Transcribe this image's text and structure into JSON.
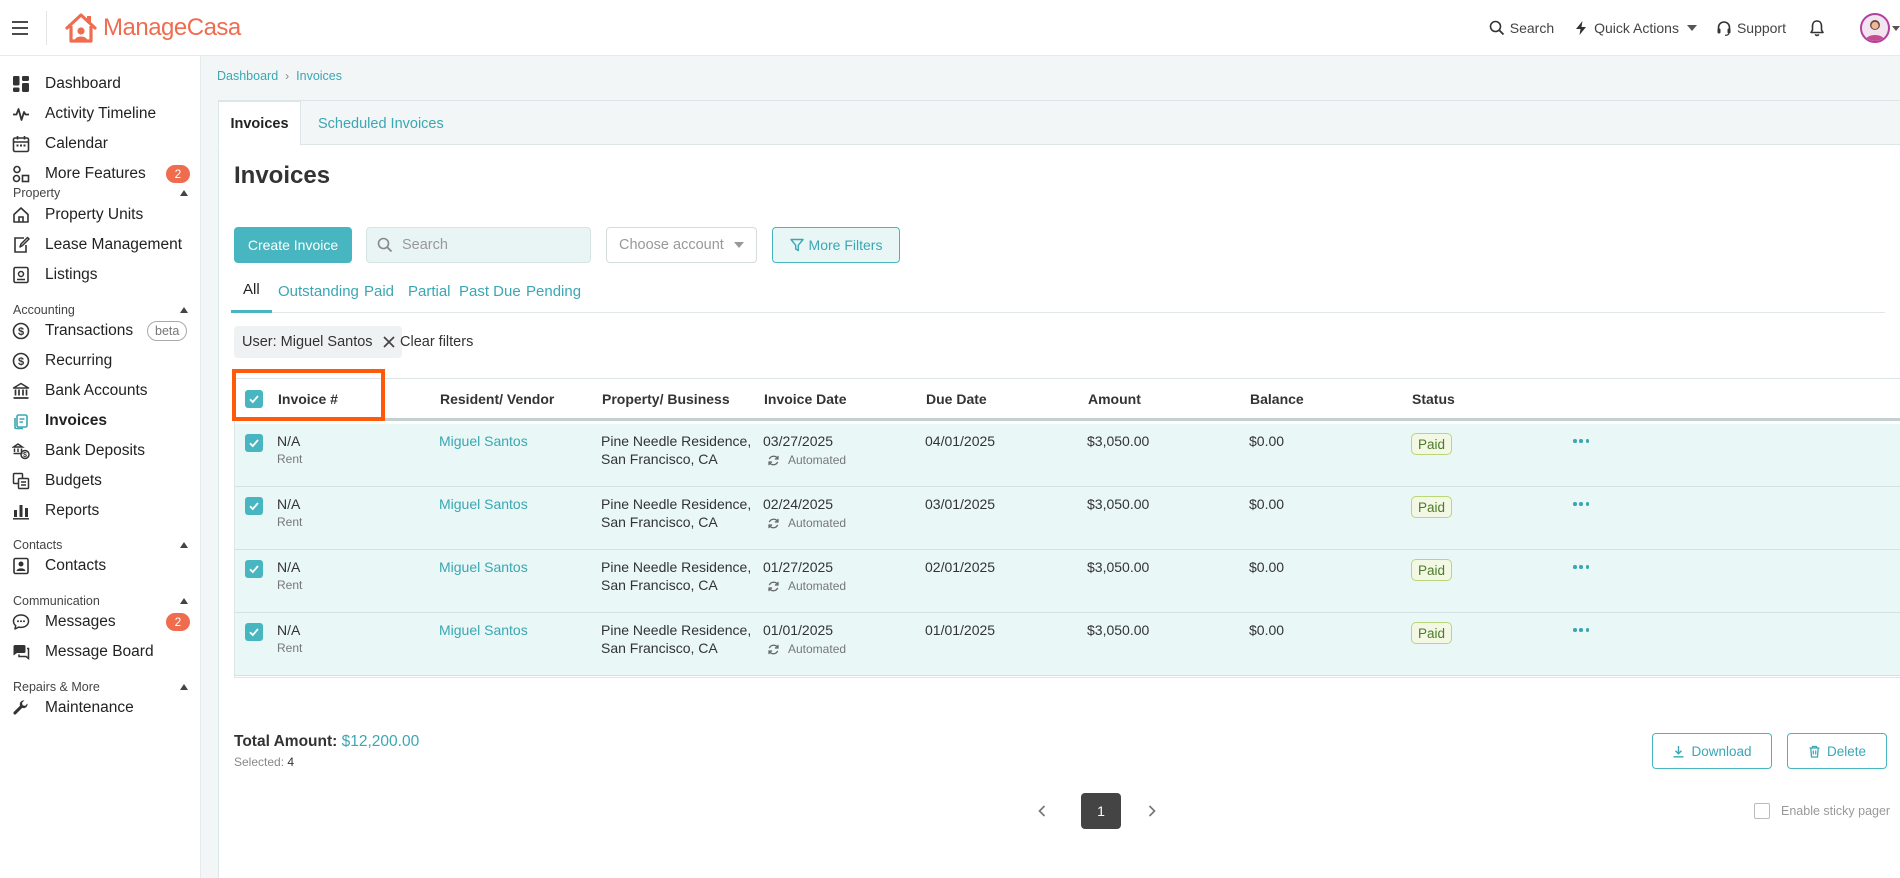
{
  "brand": {
    "name_first": "Manage",
    "name_second": "Casa",
    "color": "#ef6c4f"
  },
  "topbar": {
    "search_label": "Search",
    "quick_actions_label": "Quick Actions",
    "support_label": "Support"
  },
  "sidebar": {
    "items": [
      {
        "label": "Dashboard",
        "icon": "dashboard-icon"
      },
      {
        "label": "Activity Timeline",
        "icon": "pulse-icon"
      },
      {
        "label": "Calendar",
        "icon": "calendar-icon"
      },
      {
        "label": "More Features",
        "icon": "features-icon",
        "badge": "2"
      },
      {
        "label": "Property Units",
        "icon": "home-icon"
      },
      {
        "label": "Lease Management",
        "icon": "lease-icon"
      },
      {
        "label": "Listings",
        "icon": "listings-icon"
      },
      {
        "label": "Transactions",
        "icon": "dollar-icon",
        "pill": "beta"
      },
      {
        "label": "Recurring",
        "icon": "dollar-icon"
      },
      {
        "label": "Bank Accounts",
        "icon": "bank-icon"
      },
      {
        "label": "Invoices",
        "icon": "invoice-icon",
        "active": true
      },
      {
        "label": "Bank Deposits",
        "icon": "deposit-icon"
      },
      {
        "label": "Budgets",
        "icon": "budgets-icon"
      },
      {
        "label": "Reports",
        "icon": "reports-icon"
      },
      {
        "label": "Contacts",
        "icon": "contacts-icon"
      },
      {
        "label": "Messages",
        "icon": "messages-icon",
        "badge": "2"
      },
      {
        "label": "Message Board",
        "icon": "board-icon"
      },
      {
        "label": "Maintenance",
        "icon": "wrench-icon"
      }
    ],
    "sections": {
      "property": "Property",
      "accounting": "Accounting",
      "contacts": "Contacts",
      "communication": "Communication",
      "repairs": "Repairs & More"
    }
  },
  "breadcrumb": {
    "root": "Dashboard",
    "current": "Invoices"
  },
  "tabs": {
    "invoices": "Invoices",
    "scheduled": "Scheduled Invoices"
  },
  "page": {
    "title": "Invoices"
  },
  "toolbar": {
    "create_label": "Create Invoice",
    "search_placeholder": "Search",
    "account_placeholder": "Choose account",
    "filters_label": "More Filters"
  },
  "status_tabs": [
    "All",
    "Outstanding",
    "Paid",
    "Partial",
    "Past Due",
    "Pending"
  ],
  "filter_chip": {
    "label": "User: Miguel Santos",
    "clear_label": "Clear filters"
  },
  "table": {
    "columns": [
      "Invoice #",
      "Resident/ Vendor",
      "Property/ Business",
      "Invoice Date",
      "Due Date",
      "Amount",
      "Balance",
      "Status"
    ],
    "rows": [
      {
        "invoice": "N/A",
        "type": "Rent",
        "resident": "Miguel Santos",
        "property_line1": "Pine Needle Residence,",
        "property_line2": "San Francisco, CA",
        "invoice_date": "03/27/2025",
        "automated": "Automated",
        "due_date": "04/01/2025",
        "amount": "$3,050.00",
        "balance": "$0.00",
        "status": "Paid"
      },
      {
        "invoice": "N/A",
        "type": "Rent",
        "resident": "Miguel Santos",
        "property_line1": "Pine Needle Residence,",
        "property_line2": "San Francisco, CA",
        "invoice_date": "02/24/2025",
        "automated": "Automated",
        "due_date": "03/01/2025",
        "amount": "$3,050.00",
        "balance": "$0.00",
        "status": "Paid"
      },
      {
        "invoice": "N/A",
        "type": "Rent",
        "resident": "Miguel Santos",
        "property_line1": "Pine Needle Residence,",
        "property_line2": "San Francisco, CA",
        "invoice_date": "01/27/2025",
        "automated": "Automated",
        "due_date": "02/01/2025",
        "amount": "$3,050.00",
        "balance": "$0.00",
        "status": "Paid"
      },
      {
        "invoice": "N/A",
        "type": "Rent",
        "resident": "Miguel Santos",
        "property_line1": "Pine Needle Residence,",
        "property_line2": "San Francisco, CA",
        "invoice_date": "01/01/2025",
        "automated": "Automated",
        "due_date": "01/01/2025",
        "amount": "$3,050.00",
        "balance": "$0.00",
        "status": "Paid"
      }
    ]
  },
  "summary": {
    "total_label": "Total Amount:",
    "total_value": "$12,200.00",
    "selected_label": "Selected:",
    "selected_count": "4",
    "download_label": "Download",
    "delete_label": "Delete"
  },
  "pager": {
    "current": "1",
    "sticky_label": "Enable sticky pager"
  },
  "colors": {
    "accent": "#48b6c0",
    "link": "#3aa7b3",
    "highlight": "#ff5a0a",
    "paid_border": "#b7d77a"
  }
}
